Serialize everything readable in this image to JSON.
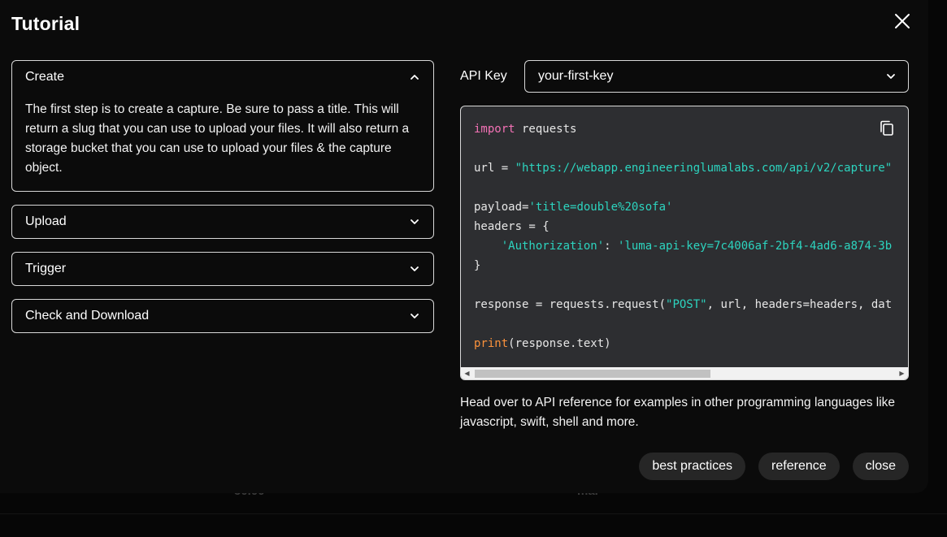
{
  "modal": {
    "title": "Tutorial"
  },
  "background": {
    "ghost_value": "50.00",
    "ghost_label": "ma."
  },
  "accordion": {
    "items": [
      {
        "label": "Create",
        "expanded": true,
        "body": "The first step is to create a capture. Be sure to pass a title. This will return a slug that you can use to upload your files. It will also return a storage bucket that you can use to upload your files & the capture object."
      },
      {
        "label": "Upload",
        "expanded": false
      },
      {
        "label": "Trigger",
        "expanded": false
      },
      {
        "label": "Check and Download",
        "expanded": false
      }
    ]
  },
  "api_key": {
    "label": "API Key",
    "selected": "your-first-key"
  },
  "code": {
    "line1_kw": "import",
    "line1_rest": " requests",
    "line3_prefix": "url = ",
    "line3_str": "\"https://webapp.engineeringlumalabs.com/api/v2/capture\"",
    "line5_prefix": "payload=",
    "line5_str": "'title=double%20sofa'",
    "line6": "headers = {",
    "line7_indent": "    ",
    "line7_key": "'Authorization'",
    "line7_sep": ": ",
    "line7_val": "'luma-api-key=7c4006af-2bf4-4ad6-a874-3b",
    "line8": "}",
    "line10_prefix": "response = requests.request(",
    "line10_str": "\"POST\"",
    "line10_rest": ", url, headers=headers, dat",
    "line12_fn": "print",
    "line12_rest": "(response.text)"
  },
  "note": "Head over to API reference for examples in other programming languages like javascript, swift, shell and more.",
  "buttons": {
    "best_practices": "best practices",
    "reference": "reference",
    "close": "close"
  },
  "colors": {
    "keyword": "#f472b6",
    "string": "#2dd4bf",
    "function": "#fb923c",
    "code_bg": "#2d2e31"
  }
}
